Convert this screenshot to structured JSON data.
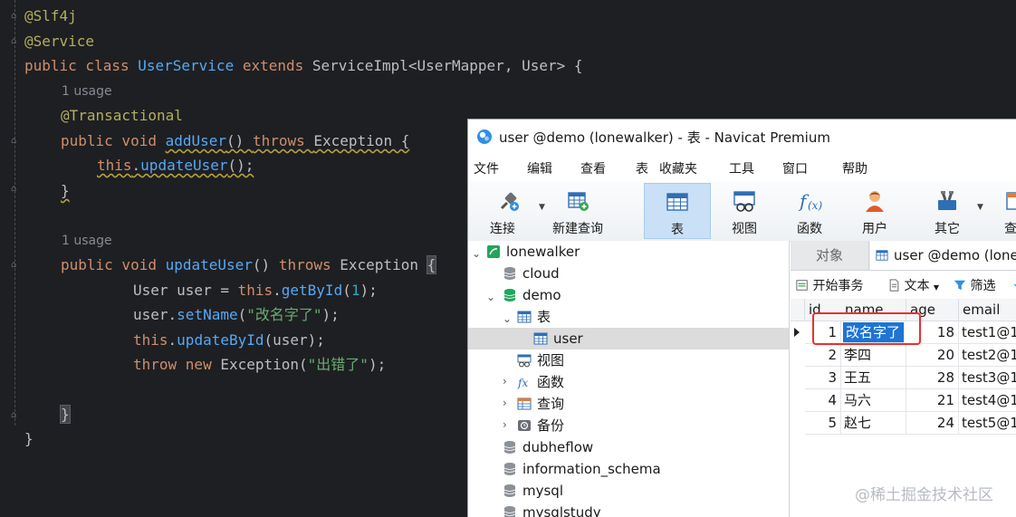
{
  "editor": {
    "usage_label_1": "1 usage",
    "usage_label_2": "1 usage",
    "code": {
      "l1_ann": "@Slf4j",
      "l2_ann": "@Service",
      "l3_kw1": "public class ",
      "l3_cls": "UserService ",
      "l3_kw2": "extends ",
      "l3_rest": "ServiceImpl<UserMapper, User> {",
      "l4_ann": "@Transactional",
      "l5_kw1": "public void ",
      "l5_fn": "addUser",
      "l5_p": "() ",
      "l5_kw2": "throws ",
      "l5_ex": "Exception {",
      "l6_kw": "this",
      "l6_dot": ".",
      "l6_fn": "updateUser",
      "l6_end": "();",
      "l7_brace": "}",
      "l8_kw1": "public void ",
      "l8_fn": "updateUser",
      "l8_p": "() ",
      "l8_kw2": "throws ",
      "l8_ex": "Exception ",
      "l8_brace": "{",
      "l9_t": "User user = ",
      "l9_kw": "this",
      "l9_d": ".",
      "l9_fn": "getById",
      "l9_o": "(",
      "l9_n": "1",
      "l9_c": ");",
      "l10_a": "user.",
      "l10_fn": "setName",
      "l10_o": "(",
      "l10_s": "\"改名字了\"",
      "l10_c": ");",
      "l11_kw": "this",
      "l11_d": ".",
      "l11_fn": "updateById",
      "l11_r": "(user);",
      "l12_kw1": "throw ",
      "l12_kw2": "new ",
      "l12_ex": "Exception(",
      "l12_s": "\"出错了\"",
      "l12_c": ");",
      "l13_brace": "}",
      "l14_brace": "}"
    }
  },
  "navicat": {
    "window_title": "user @demo (lonewalker) - 表 - Navicat Premium",
    "menu": [
      "文件",
      "编辑",
      "查看",
      "表",
      "收藏夹",
      "工具",
      "窗口",
      "帮助"
    ],
    "toolbar": [
      "连接",
      "新建查询",
      "表",
      "视图",
      "函数",
      "用户",
      "其它",
      "查"
    ],
    "tree": {
      "connection": "lonewalker",
      "db_cloud": "cloud",
      "db_demo": "demo",
      "node_tables": "表",
      "table_user": "user",
      "node_views": "视图",
      "node_functions": "函数",
      "node_queries": "查询",
      "node_backups": "备份",
      "db_dubheflow": "dubheflow",
      "db_information_schema": "information_schema",
      "db_mysql": "mysql",
      "db_mysqlstudy": "mysqlstudy"
    },
    "tabs": {
      "objects": "对象",
      "user_tab": "user @demo (lonew"
    },
    "subtoolbar": {
      "begin_tx": "开始事务",
      "text": "文本",
      "filter": "筛选"
    },
    "grid": {
      "columns": [
        "id",
        "name",
        "age",
        "email"
      ],
      "rows": [
        {
          "id": "1",
          "name": "改名字了",
          "age": "18",
          "email": "test1@1"
        },
        {
          "id": "2",
          "name": "李四",
          "age": "20",
          "email": "test2@1"
        },
        {
          "id": "3",
          "name": "王五",
          "age": "28",
          "email": "test3@1"
        },
        {
          "id": "4",
          "name": "马六",
          "age": "21",
          "email": "test4@1"
        },
        {
          "id": "5",
          "name": "赵七",
          "age": "24",
          "email": "test5@1"
        }
      ]
    }
  },
  "watermark": "@稀土掘金技术社区",
  "colors": {
    "editor_bg": "#1e1f22",
    "keyword": "#cf8e6d",
    "function": "#56a8f5",
    "string": "#6aab73",
    "annotation": "#b3ae60",
    "highlight_box": "#e8312b",
    "selection_blue": "#1f74d4"
  }
}
